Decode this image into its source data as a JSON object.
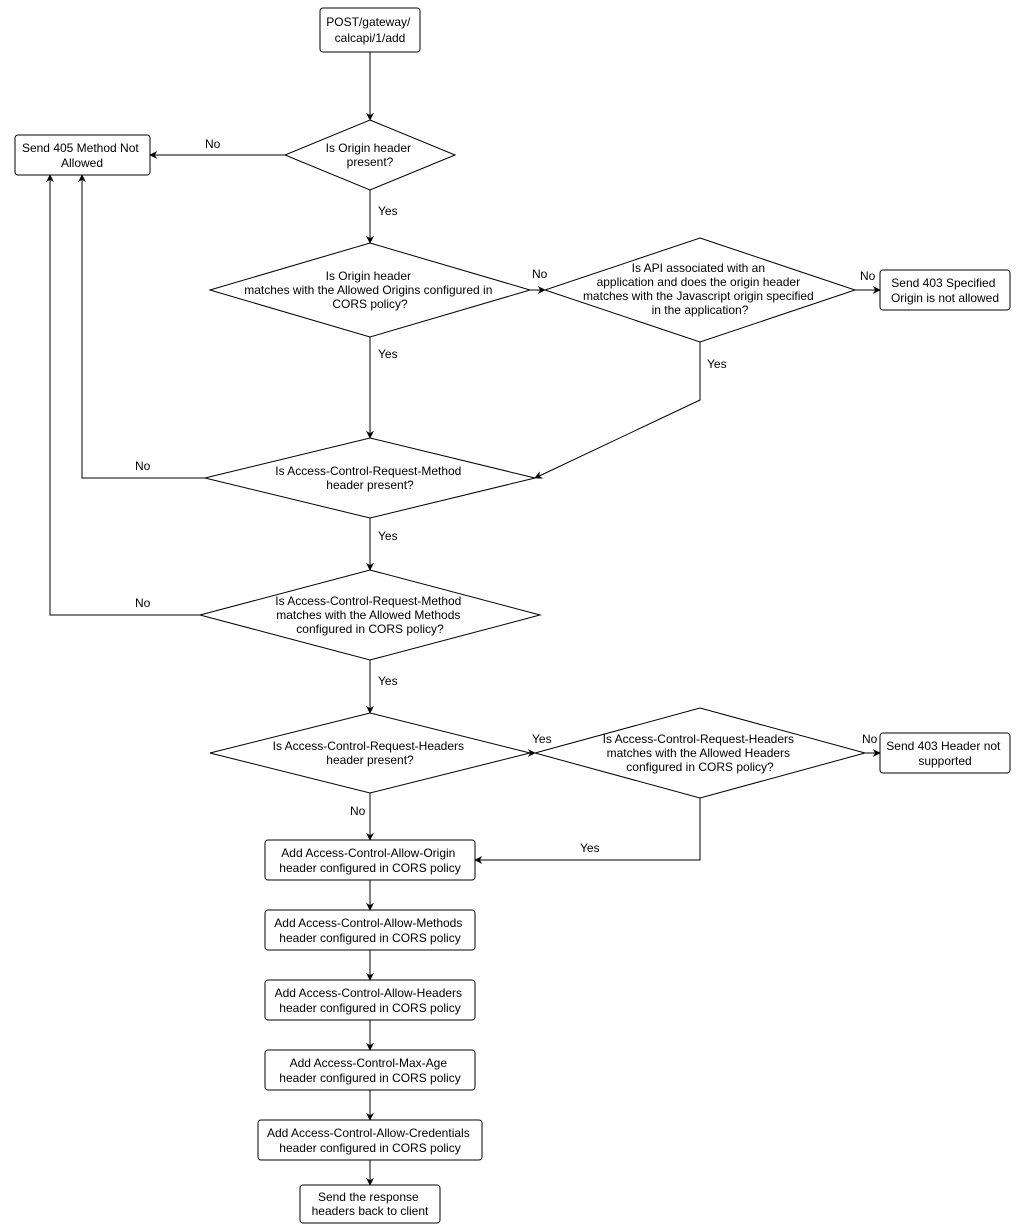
{
  "nodes": {
    "start": {
      "text": "POST/gateway/\ncalcapi/1/add"
    },
    "d1": {
      "text": "Is Origin header\npresent?"
    },
    "send405": {
      "text": "Send 405 Method Not\nAllowed"
    },
    "d2": {
      "text": "Is Origin header\nmatches with the Allowed Origins configured in\nCORS policy?"
    },
    "d3": {
      "text": "Is API associated with an\napplication and does the origin header\nmatches with the Javascript origin specified\nin the application?"
    },
    "send403origin": {
      "text": "Send 403 Specified\nOrigin is not allowed"
    },
    "d4": {
      "text": "Is Access-Control-Request-Method\nheader present?"
    },
    "d5": {
      "text": "Is Access-Control-Request-Method\nmatches with the Allowed Methods\nconfigured in CORS policy?"
    },
    "d6": {
      "text": "Is Access-Control-Request-Headers\nheader present?"
    },
    "d7": {
      "text": "Is Access-Control-Request-Headers\nmatches with the Allowed Headers\nconfigured in CORS policy?"
    },
    "send403hdr": {
      "text": "Send 403 Header not\nsupported"
    },
    "p1": {
      "text": "Add Access-Control-Allow-Origin\nheader configured in CORS policy"
    },
    "p2": {
      "text": "Add Access-Control-Allow-Methods\nheader configured in CORS policy"
    },
    "p3": {
      "text": "Add Access-Control-Allow-Headers\nheader configured in CORS policy"
    },
    "p4": {
      "text": "Add Access-Control-Max-Age\nheader configured in CORS policy"
    },
    "p5": {
      "text": "Add Access-Control-Allow-Credentials\nheader configured in CORS policy"
    },
    "end": {
      "text": "Send the response\nheaders back to client"
    }
  },
  "edges": {
    "yes": "Yes",
    "no": "No"
  }
}
